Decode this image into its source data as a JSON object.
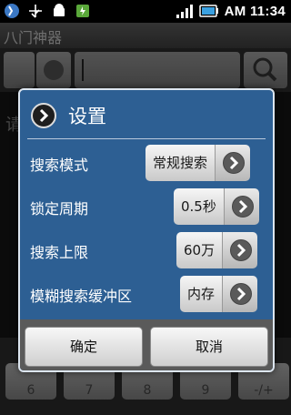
{
  "status_bar": {
    "time": "AM 11:34",
    "icons": [
      "phone-call-icon",
      "usb-icon",
      "android-icon",
      "battery-app-icon",
      "signal-icon",
      "battery-charging-icon"
    ]
  },
  "app": {
    "title": "八门神器"
  },
  "background": {
    "search_hint": "请"
  },
  "dialog": {
    "title": "设置",
    "rows": [
      {
        "label": "搜索模式",
        "value": "常规搜索"
      },
      {
        "label": "锁定周期",
        "value": "0.5秒"
      },
      {
        "label": "搜索上限",
        "value": "60万"
      },
      {
        "label": "模糊搜索缓冲区",
        "value": "内存"
      }
    ],
    "ok_label": "确定",
    "cancel_label": "取消"
  },
  "keypad": {
    "keys": [
      "6",
      "7",
      "8",
      "9",
      "-/+"
    ]
  },
  "colors": {
    "dialog_bg": "#2d5f93",
    "dialog_border": "#dde6f0",
    "footer_bg": "#5a5a5a"
  }
}
